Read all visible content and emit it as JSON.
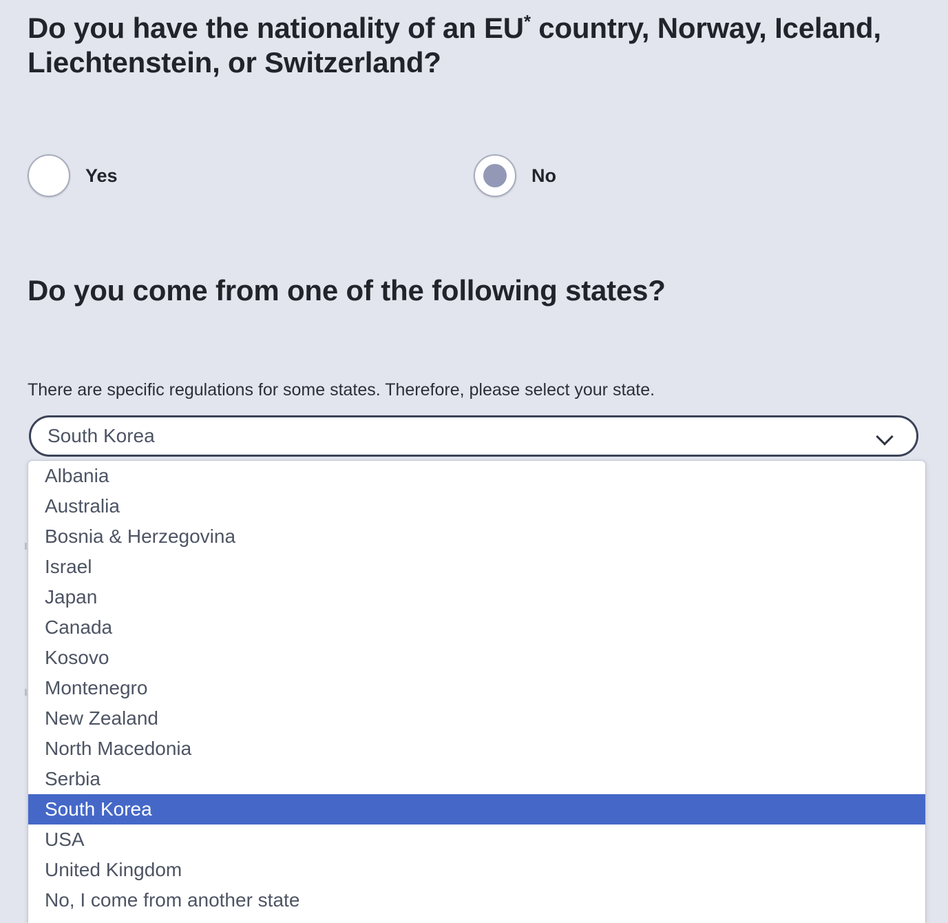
{
  "question1": {
    "text_before_sup": "Do you have the nationality of an EU",
    "sup": "*",
    "text_after_sup": " country, Norway, Iceland, Liechtenstein, or Switzerland?",
    "options": [
      {
        "label": "Yes",
        "checked": false
      },
      {
        "label": "No",
        "checked": true
      }
    ]
  },
  "question2": {
    "heading": "Do you come from one of the following states?",
    "help_text": "There are specific regulations for some states. Therefore, please select your state.",
    "select": {
      "value": "South Korea",
      "chevron_icon": "chevron-down-icon",
      "expanded": true,
      "options": [
        "Albania",
        "Australia",
        "Bosnia & Herzegovina",
        "Israel",
        "Japan",
        "Canada",
        "Kosovo",
        "Montenegro",
        "New Zealand",
        "North Macedonia",
        "Serbia",
        "South Korea",
        "USA",
        "United Kingdom",
        "No, I come from another state"
      ],
      "selected_option": "South Korea"
    }
  },
  "colors": {
    "page_background": "#e2e5ed",
    "heading_text": "#21252b",
    "body_text": "#2b3038",
    "select_border": "#3b4257",
    "select_text": "#4d5463",
    "option_highlight_background": "#4568c8",
    "option_highlight_text": "#ffffff",
    "radio_border": "#a8adbd",
    "radio_dot": "#9298b6"
  }
}
